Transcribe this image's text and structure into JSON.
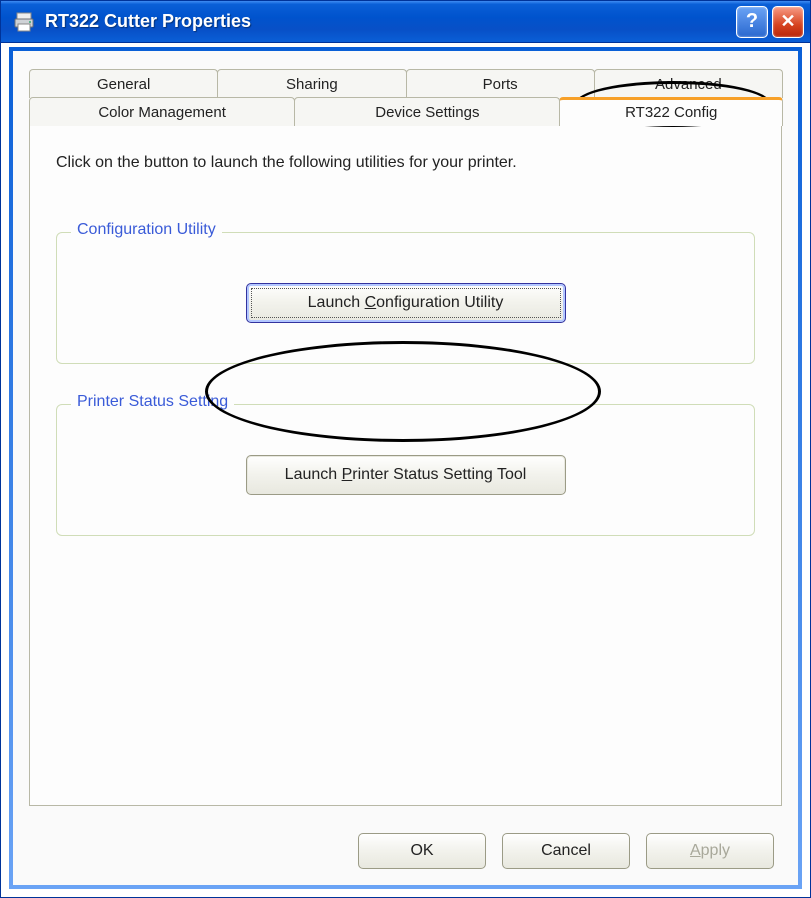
{
  "window": {
    "title": "RT322 Cutter Properties"
  },
  "tabs": {
    "row0": [
      "General",
      "Sharing",
      "Ports",
      "Advanced"
    ],
    "row1": [
      "Color Management",
      "Device Settings",
      "RT322 Config"
    ],
    "active": "RT322 Config"
  },
  "panel": {
    "instruction": "Click on the button to launch the following utilities for your printer.",
    "group1": {
      "legend": "Configuration Utility",
      "button_prefix": "Launch ",
      "button_hotkey": "C",
      "button_suffix": "onfiguration Utility"
    },
    "group2": {
      "legend": "Printer Status Setting",
      "button_prefix": "Launch ",
      "button_hotkey": "P",
      "button_suffix": "rinter Status Setting Tool"
    }
  },
  "buttons": {
    "ok": "OK",
    "cancel": "Cancel",
    "apply_hotkey": "A",
    "apply_suffix": "pply"
  }
}
